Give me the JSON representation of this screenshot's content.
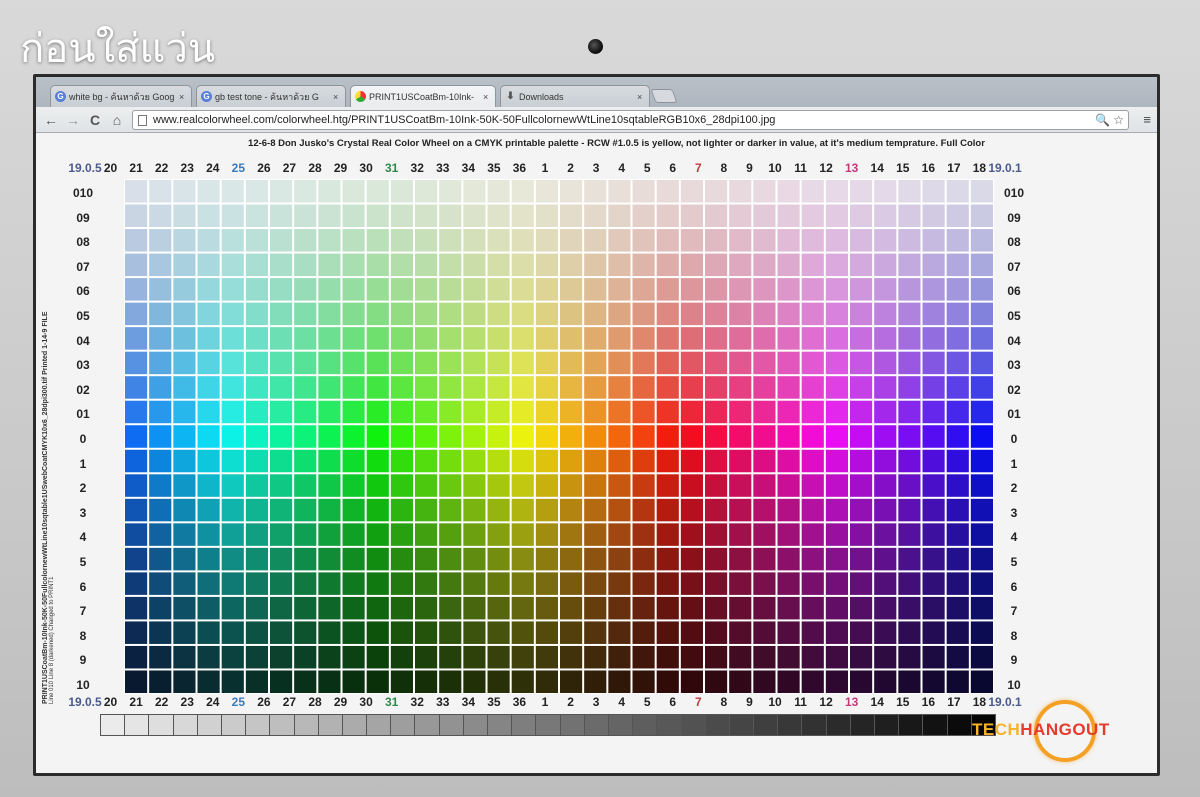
{
  "caption": "ก่อนใส่แว่น",
  "browser": {
    "tabs": [
      {
        "title": "white bg - ค้นหาด้วย Goog",
        "favicon": "google-icon",
        "active": false
      },
      {
        "title": "gb test tone - ค้นหาด้วย G",
        "favicon": "google-icon",
        "active": false
      },
      {
        "title": "PRINT1USCoatBm-10Ink-",
        "favicon": "chrome-image-icon",
        "active": true
      },
      {
        "title": "Downloads",
        "favicon": "download-icon",
        "active": false
      }
    ],
    "tab_close": "×",
    "url": "www.realcolorwheel.com/colorwheel.htg/PRINT1USCoatBm-10Ink-50K-50FullcolornewWtLine10sqtableRGB10x6_28dpi100.jpg",
    "back": "←",
    "forward": "→",
    "reload": "C",
    "home": "⌂",
    "zoom": "🔍",
    "star": "☆",
    "menu": "≡"
  },
  "page": {
    "title": "12-6-8   Don Jusko's Crystal Real Color Wheel on a CMYK printable palette - RCW #1.0.5 is yellow, not lighter or darker in value, at it's medium temprature.   Full Color",
    "side_text": "PRINT1USCoatBm-10Ink-50K-50FullcolornewWtLine10sqtable1USwebCoatCMYK10x6_28dpi300.tif    Printed 1-14-9 FILE",
    "side_text2": "Line 010 Line 8 (darkened) Changed to PRINT1",
    "hue_labels": [
      "19.0.5",
      "20",
      "21",
      "22",
      "23",
      "24",
      "25",
      "26",
      "27",
      "28",
      "29",
      "30",
      "31",
      "32",
      "33",
      "34",
      "35",
      "36",
      "1",
      "2",
      "3",
      "4",
      "5",
      "6",
      "7",
      "8",
      "9",
      "10",
      "11",
      "12",
      "13",
      "14",
      "15",
      "16",
      "17",
      "18",
      "19.0.1"
    ],
    "hue_label_colors": {
      "0": "slate",
      "6": "blue",
      "12": "green",
      "24": "red",
      "30": "magenta",
      "36": "slate"
    },
    "value_labels": [
      "010",
      "09",
      "08",
      "07",
      "06",
      "05",
      "04",
      "03",
      "02",
      "01",
      "0",
      "1",
      "2",
      "3",
      "4",
      "5",
      "6",
      "7",
      "8",
      "9",
      "10"
    ]
  },
  "logo": {
    "part1": "TECH",
    "part2": "HANGOUT"
  },
  "colors": {
    "logo_orange": "#f4a024",
    "logo_red": "#e53a2f"
  }
}
